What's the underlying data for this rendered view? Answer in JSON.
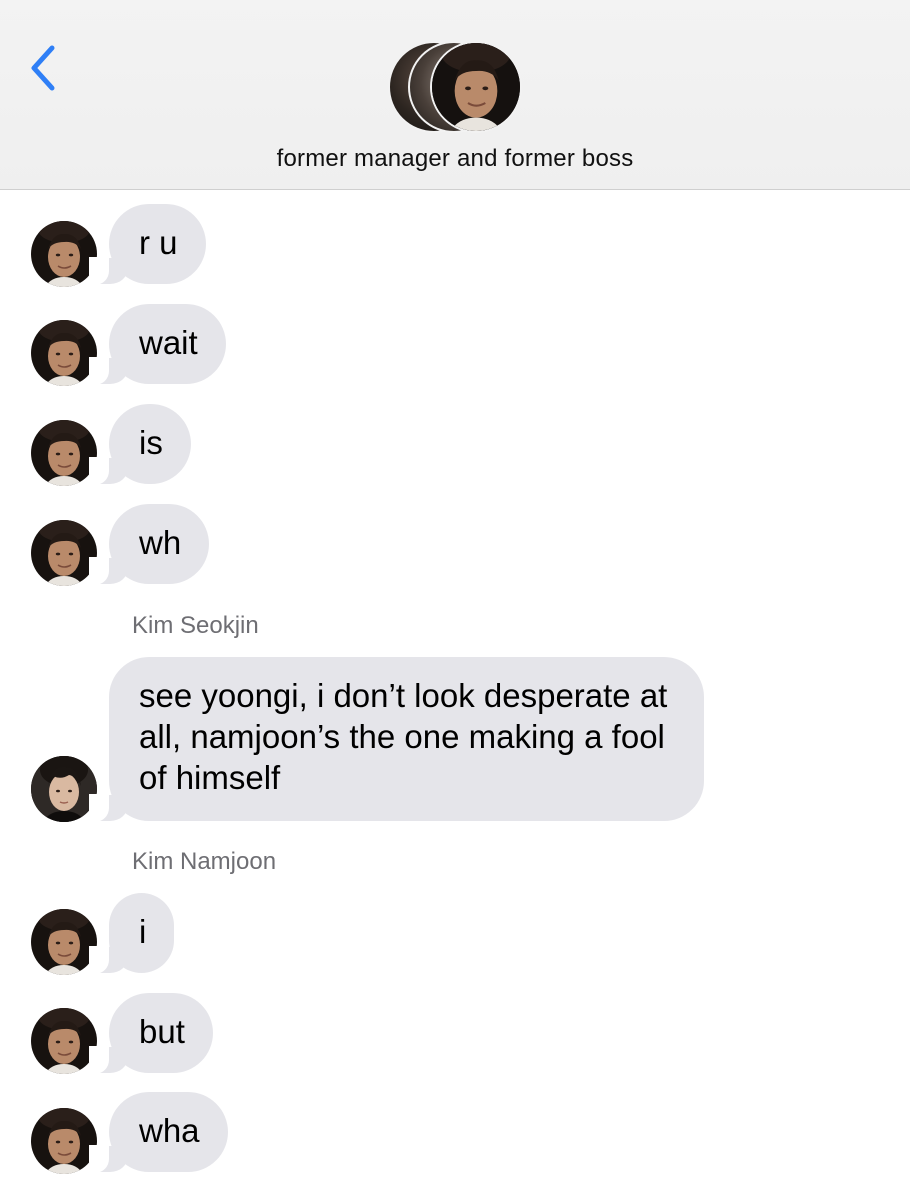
{
  "header": {
    "back_icon": "chevron-left-icon",
    "group_name": "former manager and former boss",
    "accent_color": "#2f7ff6"
  },
  "messages": [
    {
      "text": "r u"
    },
    {
      "text": "wait"
    },
    {
      "text": "is"
    },
    {
      "text": "wh"
    },
    {
      "sender": "Kim Seokjin",
      "text": "see yoongi, i don’t look desperate at all, namjoon’s the one making a fool of himself"
    },
    {
      "sender": "Kim Namjoon",
      "text": "i"
    },
    {
      "text": "but"
    },
    {
      "text": "wha"
    }
  ],
  "colors": {
    "bubble": "#e5e5ea",
    "header_bg": "#f0f0f0",
    "sender_label": "#6e6e73"
  }
}
